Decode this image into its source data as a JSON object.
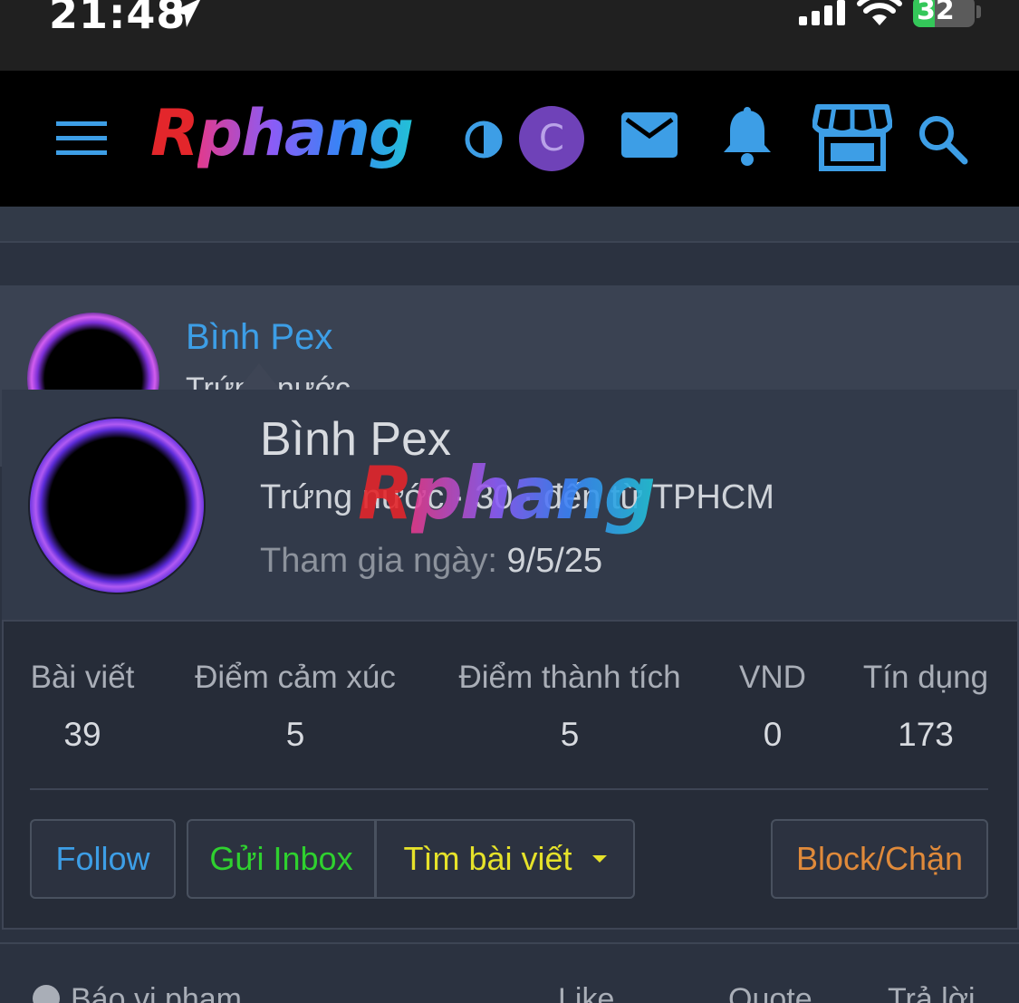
{
  "status_bar": {
    "time": "21:48",
    "battery": "32"
  },
  "header": {
    "logo_first": "R",
    "logo_rest": "phang",
    "user_avatar_letter": "C"
  },
  "background_card": {
    "name": "Bình Pex",
    "subtitle": "Trứng nước"
  },
  "member_card": {
    "name": "Bình Pex",
    "title": "Trứng nước · 30 · đến từ TPHCM",
    "joined_label": "Tham gia ngày:",
    "joined_value": "9/5/25",
    "watermark_first": "R",
    "watermark_rest": "phang",
    "stats": [
      {
        "label": "Bài viết",
        "value": "39"
      },
      {
        "label": "Điểm cảm xúc",
        "value": "5"
      },
      {
        "label": "Điểm thành tích",
        "value": "5"
      },
      {
        "label": "VND",
        "value": "0"
      },
      {
        "label": "Tín dụng",
        "value": "173"
      }
    ],
    "buttons": {
      "follow": "Follow",
      "inbox": "Gửi Inbox",
      "find_posts": "Tìm bài viết",
      "block": "Block/Chặn"
    }
  },
  "footer_row": {
    "report": "Báo vi phạm",
    "like": "Like",
    "quote": "Quote",
    "reply": "Trả lời"
  },
  "colors": {
    "accent_blue": "#3d9ee6",
    "inbox_green": "#2fd12f",
    "find_yellow": "#e6e22a",
    "block_orange": "#e08a3a",
    "avatar_purple": "#6f42b8"
  }
}
